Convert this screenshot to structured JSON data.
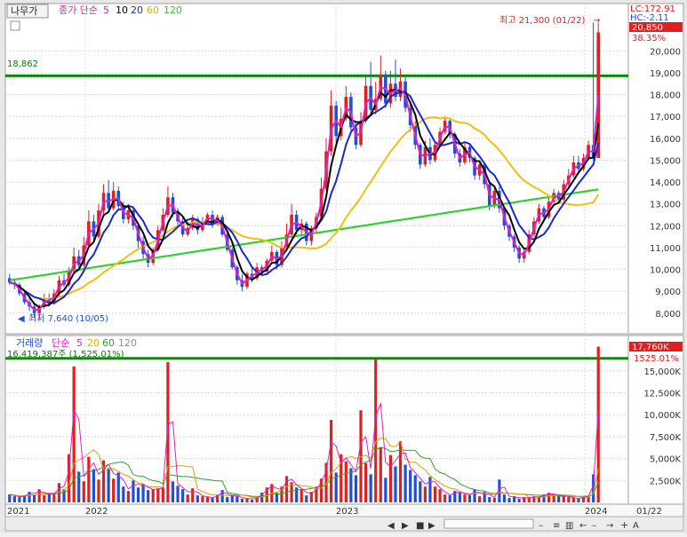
{
  "tabs": {
    "name": "나무가"
  },
  "price_legend": {
    "t1": "종가 단순",
    "p1": "5",
    "p2": "10",
    "p3": "20",
    "p4": "60",
    "p5": "120"
  },
  "volume_legend": {
    "t1": "거래량",
    "t2": "단순",
    "p1": "5",
    "p2": "20",
    "p3": "60",
    "p4": "120"
  },
  "price_panel": {
    "yticks": [
      "20,000",
      "19,000",
      "18,000",
      "17,000",
      "16,000",
      "15,000",
      "14,000",
      "13,000",
      "12,000",
      "11,000",
      "10,000",
      "9,000",
      "8,000"
    ],
    "hline_label": "18,862",
    "high_annot": "최고 21,300 (01/22)",
    "low_annot": "최저 7,640 (10/05)",
    "lc": "LC:172.91",
    "hc": "HC:-2.11",
    "last_price": "20,850",
    "last_change": "38.35%"
  },
  "volume_panel": {
    "yticks": [
      "15,000K",
      "12,500K",
      "10,000K",
      "7,500K",
      "5,000K",
      "2,500K"
    ],
    "hline_label": "16,419,387주 (1,525.01%)",
    "hline_short": "16,419",
    "last_volume": "17,760K",
    "last_pct": "1525.01%"
  },
  "x_axis": {
    "labels": [
      "2021",
      "2022",
      "2023",
      "2024",
      "01/22"
    ]
  },
  "colors": {
    "up": "#e02020",
    "down": "#1f4fd8",
    "ma5": "#e020c0",
    "ma10": "#000000",
    "ma20": "#1828d0",
    "ma60": "#f0c010",
    "ma120": "#30d030",
    "hline": "#0a8a0a"
  },
  "chart_data": {
    "type": "candlestick",
    "price_ylim": [
      7300,
      21600
    ],
    "volume_ylim": [
      0,
      16800
    ],
    "volume_unit": "K",
    "x": [
      "2021",
      "2022",
      "2023",
      "2024",
      "01/22"
    ],
    "horizontal_line_price": 18862,
    "horizontal_line_volume": 16419387,
    "high": {
      "value": 21300,
      "date": "01/22"
    },
    "low": {
      "value": 7640,
      "date": "10/05"
    },
    "candles": [
      [
        9600,
        9400,
        9800,
        9300
      ],
      [
        9400,
        9300,
        9600,
        9100
      ],
      [
        9300,
        8900,
        9400,
        8800
      ],
      [
        8900,
        8500,
        9000,
        8400
      ],
      [
        8500,
        8300,
        8700,
        8100
      ],
      [
        8300,
        8000,
        8400,
        7800
      ],
      [
        8000,
        8300,
        8400,
        7640
      ],
      [
        8300,
        8700,
        8900,
        8200
      ],
      [
        8700,
        8500,
        8900,
        8300
      ],
      [
        8500,
        8900,
        9100,
        8400
      ],
      [
        8900,
        9500,
        9700,
        8800
      ],
      [
        9500,
        9300,
        9800,
        9200
      ],
      [
        9300,
        9900,
        10100,
        9200
      ],
      [
        9900,
        10600,
        11000,
        9800
      ],
      [
        10600,
        10200,
        10900,
        10000
      ],
      [
        10200,
        11100,
        11500,
        10100
      ],
      [
        11100,
        12200,
        12700,
        11000
      ],
      [
        12200,
        11500,
        12500,
        11300
      ],
      [
        11500,
        12700,
        13000,
        11400
      ],
      [
        12700,
        13500,
        13900,
        12500
      ],
      [
        13500,
        12800,
        14100,
        12600
      ],
      [
        12800,
        13600,
        14000,
        12700
      ],
      [
        13600,
        12900,
        13800,
        12700
      ],
      [
        12900,
        12300,
        13100,
        12100
      ],
      [
        12300,
        12700,
        13000,
        12100
      ],
      [
        12700,
        12000,
        12900,
        11800
      ],
      [
        12000,
        11300,
        12100,
        11000
      ],
      [
        11300,
        10700,
        11500,
        10500
      ],
      [
        10700,
        10300,
        10900,
        10100
      ],
      [
        10300,
        10900,
        11000,
        10200
      ],
      [
        10900,
        11800,
        12000,
        10800
      ],
      [
        11800,
        12500,
        12800,
        11700
      ],
      [
        12500,
        13300,
        13800,
        12400
      ],
      [
        13300,
        12600,
        13500,
        12400
      ],
      [
        12600,
        12200,
        12800,
        12000
      ],
      [
        12200,
        11600,
        12400,
        11500
      ],
      [
        11600,
        11900,
        12100,
        11500
      ],
      [
        11900,
        12300,
        12500,
        11800
      ],
      [
        12300,
        11800,
        12400,
        11600
      ],
      [
        11800,
        12200,
        12400,
        11700
      ],
      [
        12200,
        12500,
        12600,
        12100
      ],
      [
        12500,
        12100,
        12700,
        11900
      ],
      [
        12100,
        12400,
        12500,
        12000
      ],
      [
        12400,
        11600,
        12500,
        11500
      ],
      [
        11600,
        10900,
        11700,
        10800
      ],
      [
        10900,
        10100,
        11000,
        10000
      ],
      [
        10100,
        9500,
        10200,
        9300
      ],
      [
        9500,
        9200,
        9800,
        9000
      ],
      [
        9200,
        9800,
        9900,
        9100
      ],
      [
        9800,
        9600,
        10100,
        9400
      ],
      [
        9600,
        10100,
        10300,
        9500
      ],
      [
        10100,
        9900,
        10200,
        9700
      ],
      [
        9900,
        10400,
        10500,
        9800
      ],
      [
        10400,
        10800,
        11100,
        10300
      ],
      [
        10800,
        10200,
        10900,
        10000
      ],
      [
        10200,
        11000,
        11300,
        10100
      ],
      [
        11000,
        11600,
        12100,
        10900
      ],
      [
        11600,
        12500,
        13000,
        11500
      ],
      [
        12500,
        11800,
        12700,
        11600
      ],
      [
        11800,
        12100,
        12300,
        11600
      ],
      [
        12100,
        11300,
        12200,
        11100
      ],
      [
        11300,
        11900,
        12000,
        11100
      ],
      [
        11900,
        12400,
        12600,
        11700
      ],
      [
        12400,
        13700,
        14200,
        12300
      ],
      [
        13700,
        15400,
        16000,
        13600
      ],
      [
        15400,
        17500,
        18200,
        15200
      ],
      [
        17500,
        16100,
        17700,
        15800
      ],
      [
        16100,
        16900,
        17400,
        15900
      ],
      [
        16900,
        17900,
        18400,
        16800
      ],
      [
        17900,
        16500,
        18100,
        16200
      ],
      [
        16500,
        15700,
        16800,
        15500
      ],
      [
        15700,
        16800,
        17200,
        15600
      ],
      [
        16800,
        18400,
        18900,
        16700
      ],
      [
        18400,
        17300,
        19500,
        17100
      ],
      [
        17300,
        17800,
        18600,
        17100
      ],
      [
        17800,
        18900,
        19800,
        17700
      ],
      [
        18900,
        17600,
        19100,
        17400
      ],
      [
        17600,
        18500,
        19100,
        17400
      ],
      [
        18500,
        17900,
        19600,
        17700
      ],
      [
        17900,
        18600,
        19200,
        17700
      ],
      [
        18600,
        17400,
        18800,
        17200
      ],
      [
        17400,
        16600,
        17600,
        16300
      ],
      [
        16600,
        15700,
        16800,
        15500
      ],
      [
        15700,
        14800,
        15800,
        14600
      ],
      [
        14800,
        15600,
        15900,
        14700
      ],
      [
        15600,
        15000,
        16000,
        14800
      ],
      [
        15000,
        15700,
        15800,
        14900
      ],
      [
        15700,
        16300,
        16500,
        15600
      ],
      [
        16300,
        16800,
        17000,
        16200
      ],
      [
        16800,
        16200,
        16900,
        16000
      ],
      [
        16200,
        15300,
        16300,
        15100
      ],
      [
        15300,
        14900,
        15500,
        14700
      ],
      [
        14900,
        15600,
        15800,
        14800
      ],
      [
        15600,
        15100,
        15700,
        14900
      ],
      [
        15100,
        14300,
        15200,
        14100
      ],
      [
        14300,
        14800,
        14900,
        14100
      ],
      [
        14800,
        13900,
        14900,
        13700
      ],
      [
        13900,
        12900,
        14000,
        12700
      ],
      [
        12900,
        13600,
        13800,
        12800
      ],
      [
        13600,
        12800,
        13800,
        12600
      ],
      [
        12800,
        12000,
        12900,
        11800
      ],
      [
        12000,
        11500,
        12100,
        11300
      ],
      [
        11500,
        11000,
        11600,
        10800
      ],
      [
        11000,
        10500,
        11100,
        10300
      ],
      [
        10500,
        10800,
        11000,
        10300
      ],
      [
        10800,
        11600,
        11800,
        10700
      ],
      [
        11600,
        12200,
        12400,
        11500
      ],
      [
        12200,
        12800,
        13000,
        12100
      ],
      [
        12800,
        12400,
        12900,
        12200
      ],
      [
        12400,
        13100,
        13300,
        12300
      ],
      [
        13100,
        13500,
        13700,
        13000
      ],
      [
        13500,
        13200,
        13600,
        13000
      ],
      [
        13200,
        13900,
        14100,
        13100
      ],
      [
        13900,
        14300,
        14600,
        13800
      ],
      [
        14300,
        14900,
        15200,
        14200
      ],
      [
        14900,
        14600,
        15200,
        14400
      ],
      [
        14600,
        15100,
        15300,
        14500
      ],
      [
        15100,
        15700,
        15900,
        15000
      ],
      [
        15700,
        15100,
        21300,
        15000
      ],
      [
        15100,
        20850,
        21300,
        15100
      ]
    ],
    "volume": [
      900,
      700,
      600,
      800,
      1200,
      900,
      1500,
      800,
      1100,
      900,
      2200,
      1500,
      5500,
      15500,
      3500,
      2400,
      5200,
      3800,
      2600,
      4800,
      3900,
      2700,
      3400,
      1800,
      1300,
      2500,
      1700,
      2100,
      1400,
      1500,
      1600,
      1700,
      16000,
      2400,
      1900,
      1500,
      900,
      1600,
      800,
      700,
      600,
      500,
      900,
      1400,
      600,
      900,
      700,
      400,
      500,
      300,
      600,
      1100,
      1700,
      2100,
      1100,
      1800,
      3000,
      2300,
      1700,
      1500,
      800,
      1200,
      1800,
      2700,
      4500,
      9400,
      3400,
      5500,
      4700,
      3900,
      3100,
      10500,
      4500,
      3200,
      16300,
      6300,
      2800,
      5400,
      4100,
      7000,
      4300,
      3700,
      3100,
      2400,
      1800,
      2900,
      1800,
      1500,
      900,
      800,
      1300,
      1100,
      900,
      800,
      1500,
      700,
      1200,
      600,
      500,
      2600,
      900,
      500,
      700,
      400,
      600,
      500,
      700,
      600,
      900,
      1100,
      800,
      900,
      700,
      600,
      500,
      400,
      700,
      700,
      3200,
      17760
    ],
    "series_colors": {
      "ma5": "#e020c0",
      "ma10": "#000000",
      "ma20": "#1828d0",
      "ma60": "#f0c010",
      "ma120": "#30d030"
    }
  }
}
